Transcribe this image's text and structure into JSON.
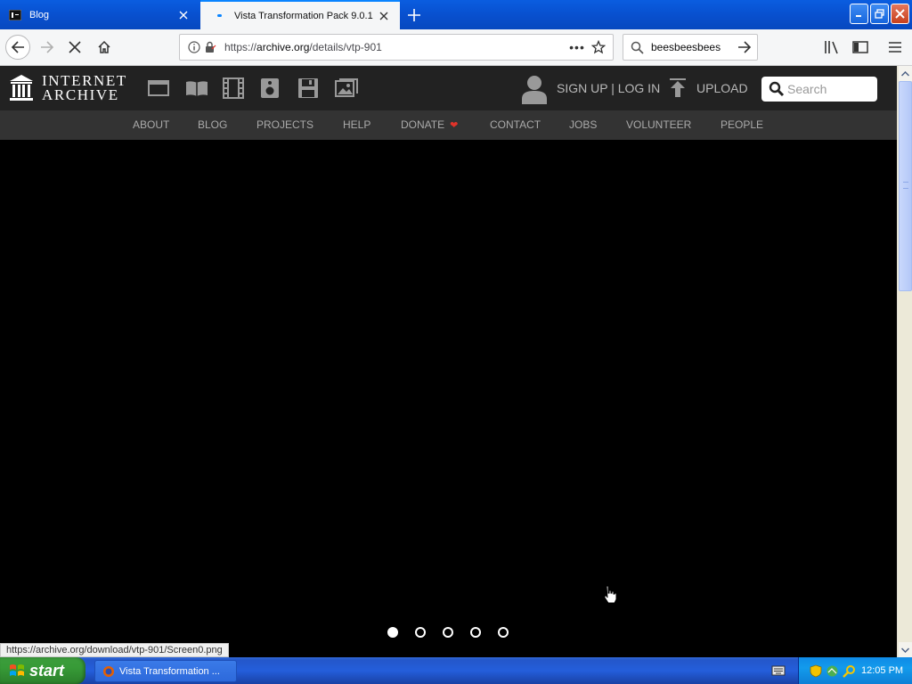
{
  "browser": {
    "tabs": [
      {
        "title": "Blog",
        "active": false
      },
      {
        "title": "Vista Transformation Pack 9.0.1 :",
        "active": true
      }
    ],
    "url_prefix": "https://",
    "url_host": "archive.org",
    "url_path": "/details/vtp-901",
    "more_label": "•••",
    "search_value": "beesbeesbees",
    "status_url": "https://archive.org/download/vtp-901/Screen0.png"
  },
  "site": {
    "logo_line1": "INTERNET",
    "logo_line2": "ARCHIVE",
    "media_icons": [
      "web-icon",
      "texts-icon",
      "video-icon",
      "audio-icon",
      "software-icon",
      "images-icon"
    ],
    "signup_label": "SIGN UP | LOG IN",
    "upload_label": "UPLOAD",
    "search_placeholder": "Search",
    "nav": [
      {
        "label": "ABOUT"
      },
      {
        "label": "BLOG"
      },
      {
        "label": "PROJECTS"
      },
      {
        "label": "HELP"
      },
      {
        "label": "DONATE"
      },
      {
        "label": "CONTACT"
      },
      {
        "label": "JOBS"
      },
      {
        "label": "VOLUNTEER"
      },
      {
        "label": "PEOPLE"
      }
    ],
    "carousel": {
      "count": 5,
      "active_index": 0
    }
  },
  "taskbar": {
    "start_label": "start",
    "task_label": "Vista Transformation ...",
    "clock": "12:05 PM"
  },
  "colors": {
    "ia_header": "#222222",
    "ia_nav": "#333333",
    "donate_heart": "#e0332a",
    "xp_start": "#3c9e3c",
    "xp_taskbar": "#245edb"
  }
}
